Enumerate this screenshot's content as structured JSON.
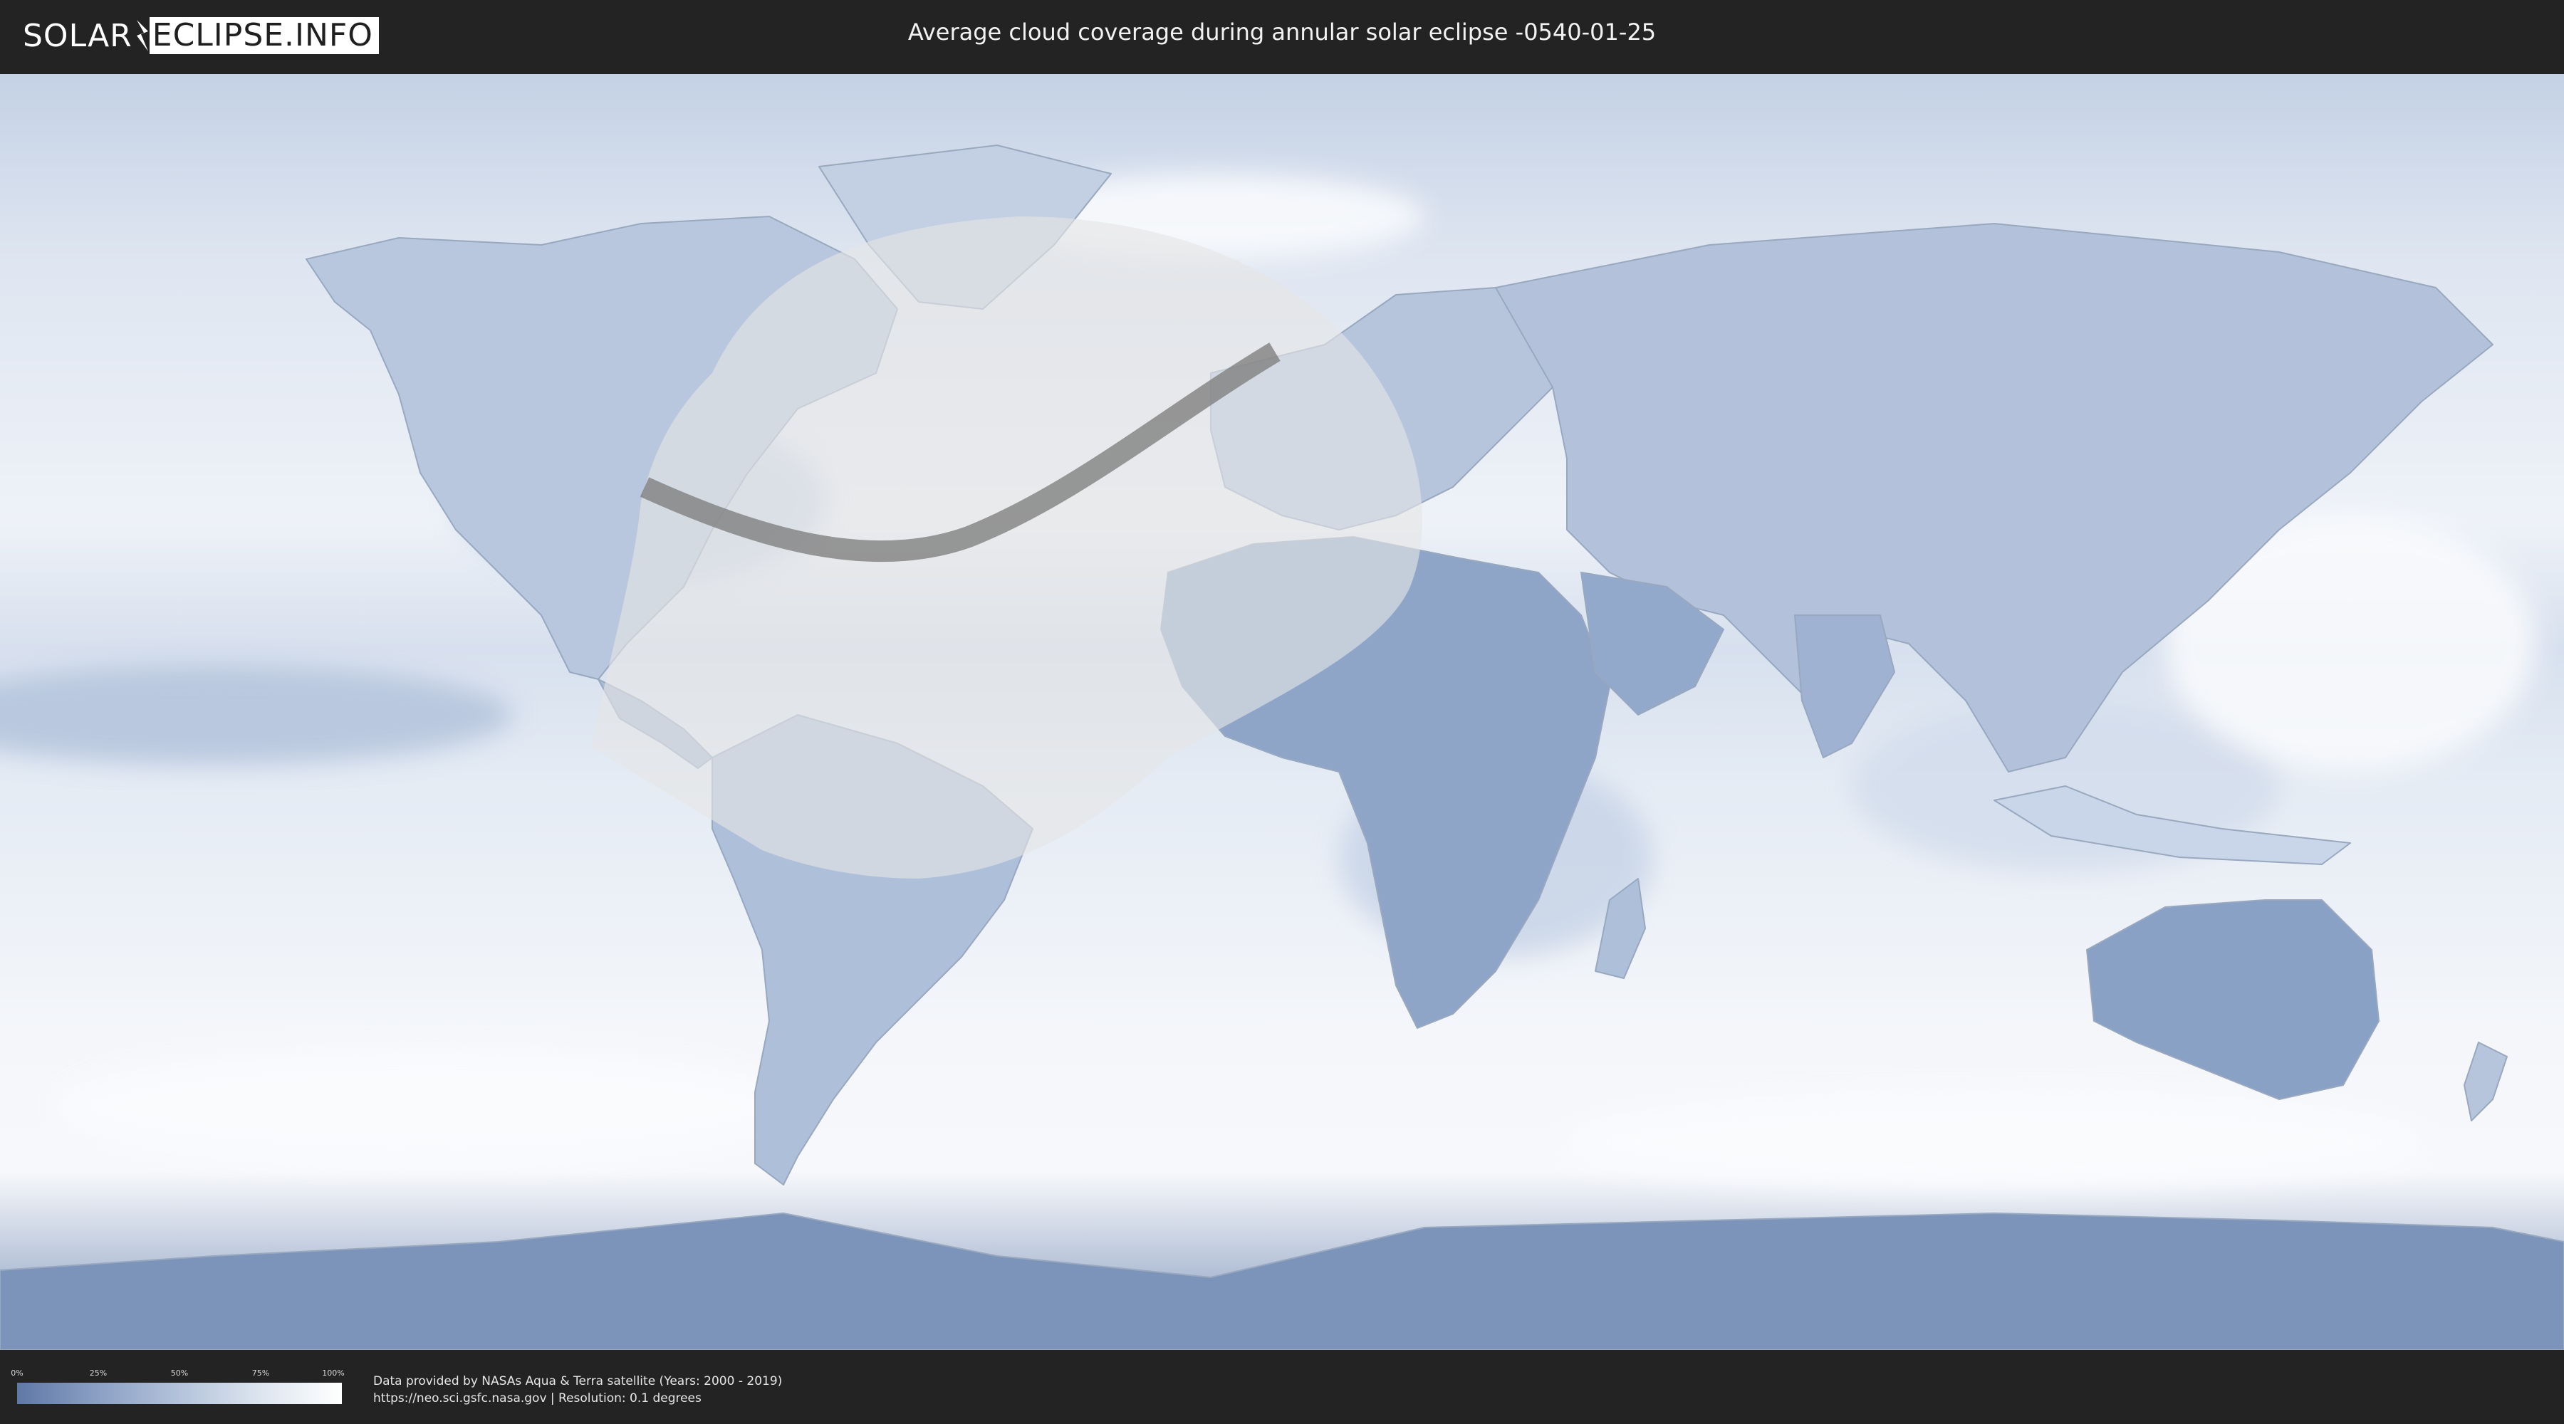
{
  "header": {
    "logo_part1": "SOLAR",
    "logo_part2": "ECLIPSE.INFO",
    "title": "Average cloud coverage during annular solar eclipse -0540-01-25"
  },
  "map": {
    "projection": "equirectangular",
    "eclipse_path_color": "#7a7a7a",
    "visibility_zone_color": "#e5e5e5",
    "land_outline_color": "#9aa7b8",
    "ocean_base_color": "#e9eef6",
    "cloud_low_color": "#5f78a6"
  },
  "legend": {
    "ticks": [
      "0%",
      "25%",
      "50%",
      "75%",
      "100%"
    ],
    "gradient_from": "#5f78a6",
    "gradient_to": "#ffffff"
  },
  "footer": {
    "credit_line1": "Data provided by NASAs Aqua & Terra satellite (Years: 2000 - 2019)",
    "credit_line2": "https://neo.sci.gsfc.nasa.gov | Resolution: 0.1 degrees"
  }
}
